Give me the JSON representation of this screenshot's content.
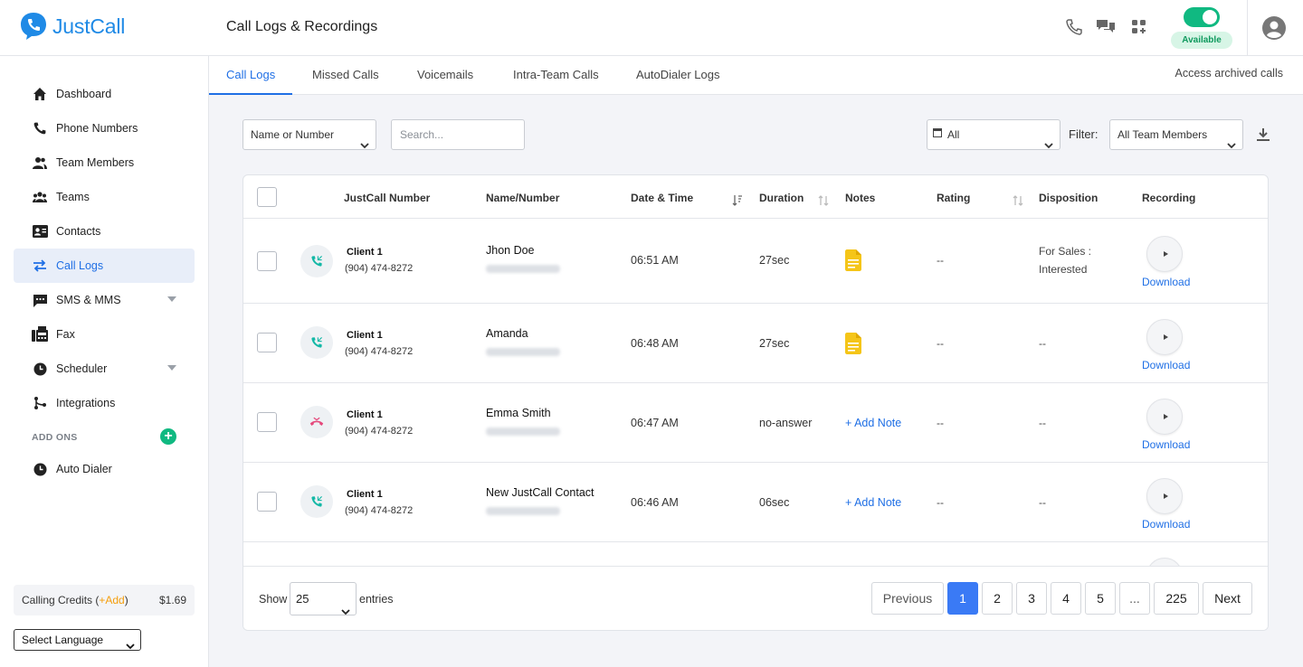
{
  "brand": {
    "name": "JustCall",
    "color": "#1f8ae6"
  },
  "header": {
    "title": "Call Logs & Recordings",
    "status": "Available",
    "icons": [
      "phone-icon",
      "chat-icon",
      "apps-icon",
      "user-avatar-icon"
    ]
  },
  "sidebar": {
    "items": [
      {
        "label": "Dashboard",
        "icon": "home-icon"
      },
      {
        "label": "Phone Numbers",
        "icon": "phone-icon"
      },
      {
        "label": "Team Members",
        "icon": "people-icon"
      },
      {
        "label": "Teams",
        "icon": "group-icon"
      },
      {
        "label": "Contacts",
        "icon": "contact-card-icon"
      },
      {
        "label": "Call Logs",
        "icon": "swap-arrows-icon",
        "active": true
      },
      {
        "label": "SMS & MMS",
        "icon": "sms-icon",
        "expandable": true
      },
      {
        "label": "Fax",
        "icon": "fax-icon"
      },
      {
        "label": "Scheduler",
        "icon": "clock-icon",
        "expandable": true
      },
      {
        "label": "Integrations",
        "icon": "integrations-icon"
      }
    ],
    "addons_label": "ADD ONS",
    "addon_items": [
      {
        "label": "Auto Dialer",
        "icon": "clock-icon"
      }
    ],
    "credits": {
      "label": "Calling Credits (",
      "add": "+Add",
      "close": ")",
      "amount": "$1.69"
    },
    "language": "Select Language"
  },
  "tabs": [
    {
      "label": "Call Logs",
      "active": true
    },
    {
      "label": "Missed Calls"
    },
    {
      "label": "Voicemails"
    },
    {
      "label": "Intra-Team Calls"
    },
    {
      "label": "AutoDialer Logs"
    }
  ],
  "archived_link": "Access archived calls",
  "filters": {
    "search_by": "Name or Number",
    "search_placeholder": "Search...",
    "date_range": "All",
    "filter_label": "Filter:",
    "team_filter": "All Team Members"
  },
  "table": {
    "columns": [
      "JustCall Number",
      "Name/Number",
      "Date & Time",
      "Duration",
      "Notes",
      "Rating",
      "Disposition",
      "Recording"
    ],
    "rows": [
      {
        "justcall_name": "Client 1",
        "justcall_number": "(904) 474-8272",
        "contact": "Jhon Doe",
        "time": "06:51 AM",
        "duration": "27sec",
        "note": "icon",
        "rating": "--",
        "disposition": "For Sales : Interested",
        "recording": "Download",
        "status": "completed"
      },
      {
        "justcall_name": "Client 1",
        "justcall_number": "(904) 474-8272",
        "contact": "Amanda",
        "time": "06:48 AM",
        "duration": "27sec",
        "note": "icon",
        "rating": "--",
        "disposition": "--",
        "recording": "Download",
        "status": "completed"
      },
      {
        "justcall_name": "Client 1",
        "justcall_number": "(904) 474-8272",
        "contact": "Emma Smith",
        "time": "06:47 AM",
        "duration": "no-answer",
        "note": "+ Add Note",
        "rating": "--",
        "disposition": "--",
        "recording": "Download",
        "status": "missed"
      },
      {
        "justcall_name": "Client 1",
        "justcall_number": "(904) 474-8272",
        "contact": "New JustCall Contact",
        "time": "06:46 AM",
        "duration": "06sec",
        "note": "+ Add Note",
        "rating": "--",
        "disposition": "--",
        "recording": "Download",
        "status": "completed"
      }
    ]
  },
  "footer": {
    "show_label": "Show",
    "page_size": "25",
    "entries_label": "entries",
    "pagination": [
      "Previous",
      "1",
      "2",
      "3",
      "4",
      "5",
      "...",
      "225",
      "Next"
    ],
    "current_page": "1"
  },
  "colors": {
    "accent": "#1f6fe5",
    "success": "#10b981",
    "note_yellow": "#f5c518",
    "missed": "#e5487b",
    "incoming": "#13b8a6"
  }
}
